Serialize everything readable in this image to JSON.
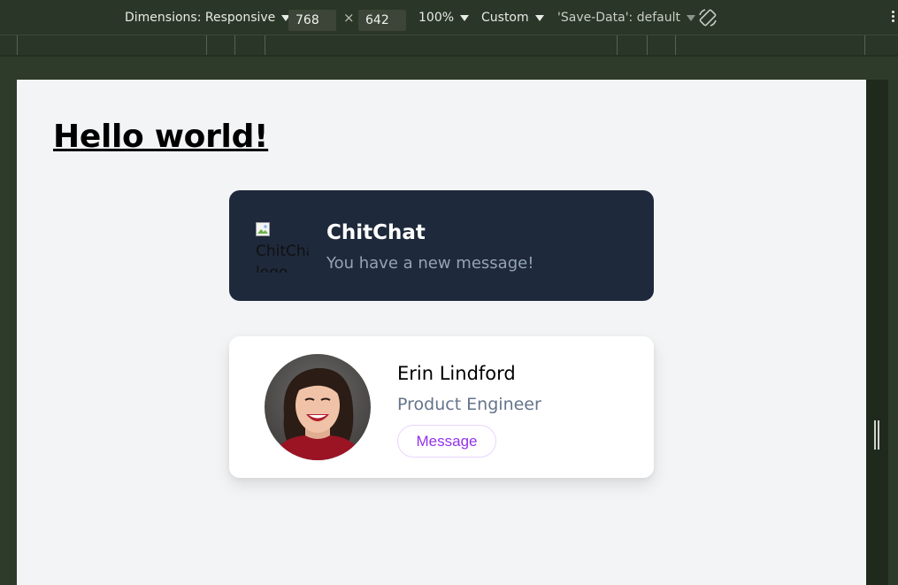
{
  "toolbar": {
    "dimensions_label": "Dimensions: Responsive",
    "width_value": "768",
    "times_sign": "×",
    "height_value": "642",
    "zoom": "100%",
    "throttling": "Custom",
    "save_data": "'Save-Data': default"
  },
  "page": {
    "title": "Hello world!"
  },
  "notification": {
    "logo_alt": "ChitChat logo",
    "title": "ChitChat",
    "message": "You have a new message!"
  },
  "profile": {
    "name": "Erin Lindford",
    "role": "Product Engineer",
    "button_label": "Message"
  },
  "colors": {
    "notification_bg": "#1e293b",
    "button_text": "#9333ea",
    "role_text": "#64748b"
  }
}
